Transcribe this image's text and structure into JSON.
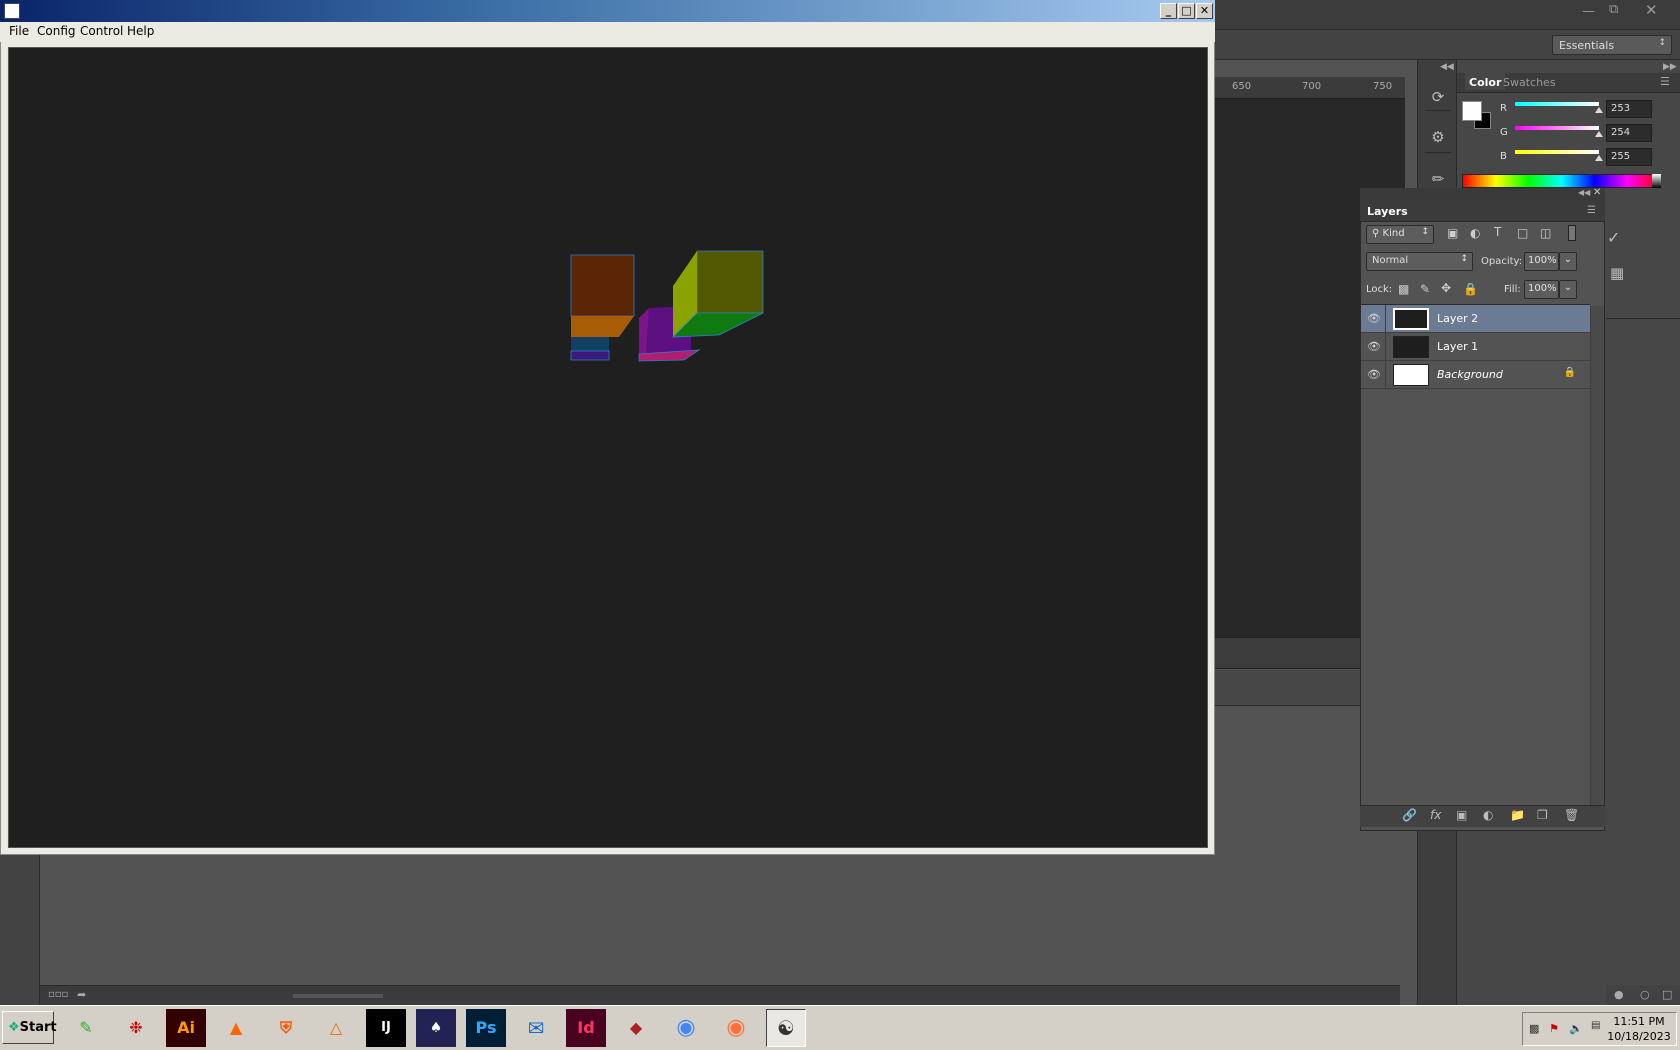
{
  "photoshop": {
    "workspace": "Essentials",
    "ruler_ticks": [
      "650",
      "700",
      "750"
    ],
    "color_panel": {
      "tabs": [
        "Color",
        "Swatches"
      ],
      "r": "253",
      "g": "254",
      "b": "255",
      "r_label": "R",
      "g_label": "G",
      "b_label": "B",
      "foreground_color": "#fdfeff",
      "background_color": "#000000"
    },
    "layers_panel": {
      "title": "Layers",
      "filter_kind": "Kind",
      "blend_mode": "Normal",
      "opacity_label": "Opacity:",
      "opacity": "100%",
      "lock_label": "Lock:",
      "fill_label": "Fill:",
      "fill": "100%",
      "layers": [
        {
          "name": "Layer 2",
          "selected": true
        },
        {
          "name": "Layer 1",
          "selected": false
        },
        {
          "name": "Background",
          "selected": false,
          "locked": true
        }
      ]
    }
  },
  "app_window": {
    "menu": [
      "File",
      "Config",
      "Control",
      "Help"
    ],
    "canvas_background": "#1f1f1f"
  },
  "taskbar": {
    "start_label": "Start",
    "apps": [
      "notepad-icon",
      "acrobat-icon",
      "illustrator-icon",
      "vlc-icon",
      "brave-icon",
      "matlab-icon",
      "intellij-icon",
      "mysql-workbench-icon",
      "photoshop-icon",
      "thunderbird-icon",
      "indesign-icon",
      "app-icon",
      "chrome-icon",
      "firefox-icon",
      "java-icon"
    ],
    "app_labels": {
      "illustrator": "Ai",
      "intellij": "IJ",
      "photoshop": "Ps",
      "indesign": "Id"
    },
    "time": "11:51 PM",
    "date": "10/18/2023"
  }
}
